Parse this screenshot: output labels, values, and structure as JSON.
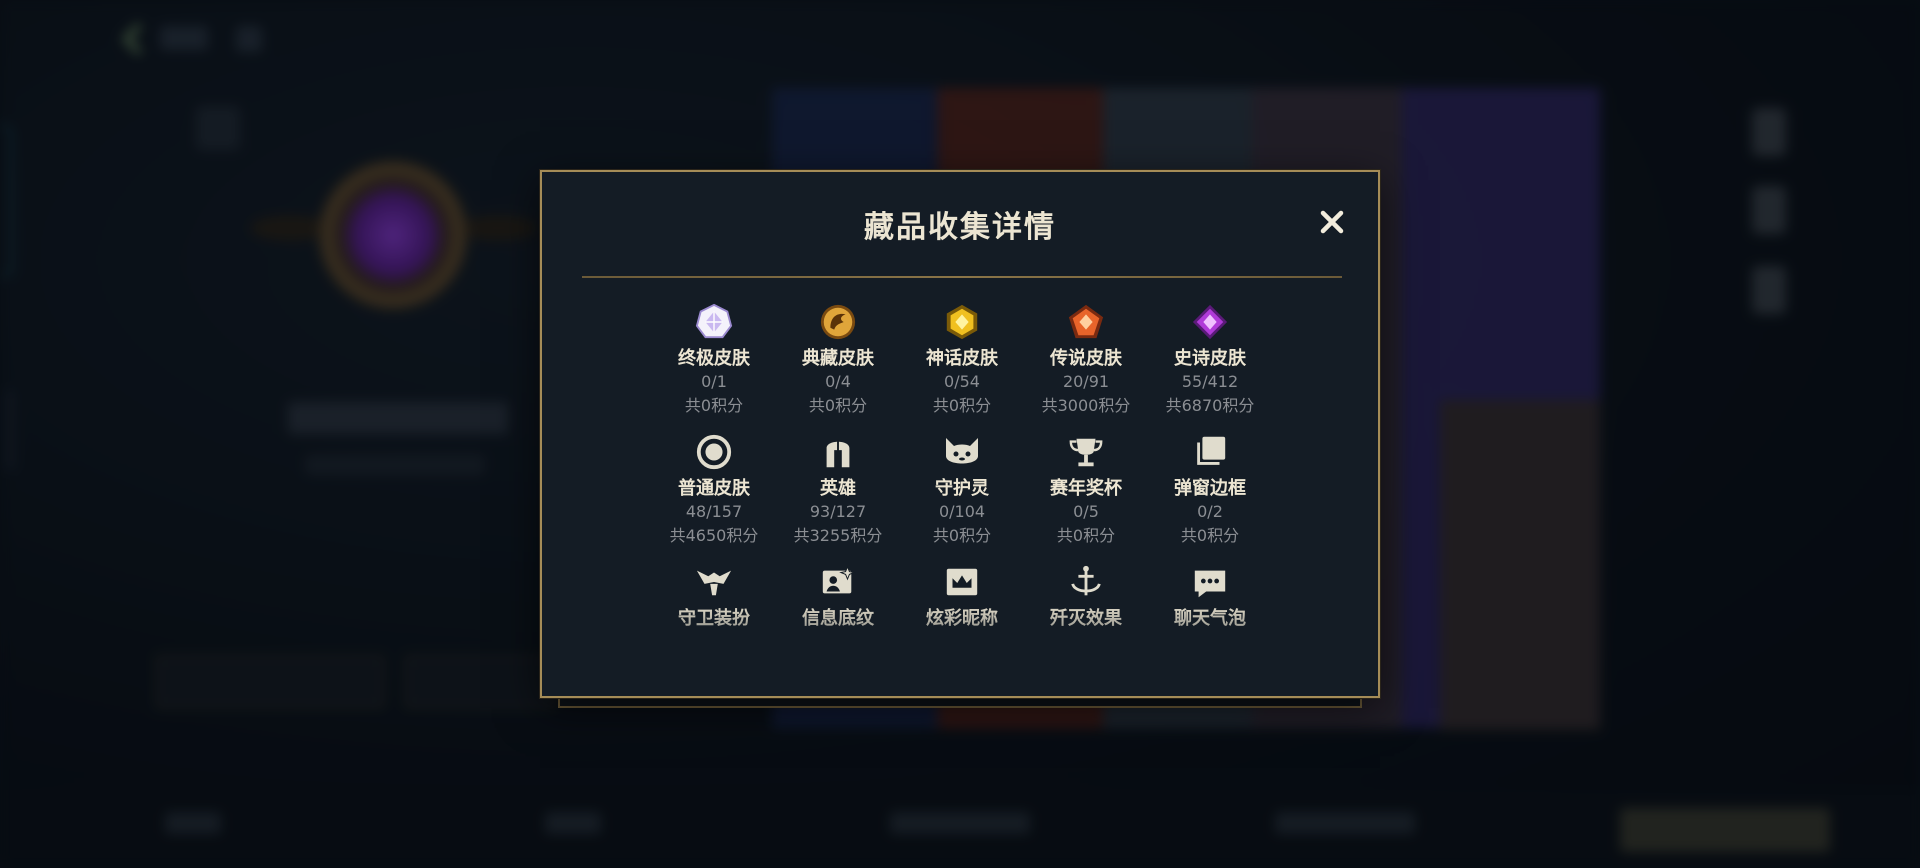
{
  "modal": {
    "title": "藏品收集详情",
    "close_icon": "close-icon"
  },
  "collections": [
    {
      "icon": "ultimate-skin-icon",
      "name": "终极皮肤",
      "count": "0/1",
      "points": "共0积分",
      "color": "#c9b8f0"
    },
    {
      "icon": "classic-skin-icon",
      "name": "典藏皮肤",
      "count": "0/4",
      "points": "共0积分",
      "color": "#e0a53a"
    },
    {
      "icon": "mythic-skin-icon",
      "name": "神话皮肤",
      "count": "0/54",
      "points": "共0积分",
      "color": "#f0c020"
    },
    {
      "icon": "legendary-skin-icon",
      "name": "传说皮肤",
      "count": "20/91",
      "points": "共3000积分",
      "color": "#e8642a"
    },
    {
      "icon": "epic-skin-icon",
      "name": "史诗皮肤",
      "count": "55/412",
      "points": "共6870积分",
      "color": "#b03ad8"
    },
    {
      "icon": "normal-skin-icon",
      "name": "普通皮肤",
      "count": "48/157",
      "points": "共4650积分",
      "color": "#e0dccd"
    },
    {
      "icon": "hero-helmet-icon",
      "name": "英雄",
      "count": "93/127",
      "points": "共3255积分",
      "color": "#e0dccd"
    },
    {
      "icon": "guardian-spirit-icon",
      "name": "守护灵",
      "count": "0/104",
      "points": "共0积分",
      "color": "#e0dccd"
    },
    {
      "icon": "trophy-icon",
      "name": "赛年奖杯",
      "count": "0/5",
      "points": "共0积分",
      "color": "#e0dccd"
    },
    {
      "icon": "popup-frame-icon",
      "name": "弹窗边框",
      "count": "0/2",
      "points": "共0积分",
      "color": "#e0dccd"
    },
    {
      "icon": "guardian-outfit-icon",
      "name": "守卫装扮",
      "count": "",
      "points": "",
      "color": "#e0dccd"
    },
    {
      "icon": "profile-card-icon",
      "name": "信息底纹",
      "count": "",
      "points": "",
      "color": "#e0dccd"
    },
    {
      "icon": "nickname-crown-icon",
      "name": "炫彩昵称",
      "count": "",
      "points": "",
      "color": "#e0dccd"
    },
    {
      "icon": "dunk-effect-icon",
      "name": "歼灭效果",
      "count": "",
      "points": "",
      "color": "#e0dccd"
    },
    {
      "icon": "chat-bubble-icon",
      "name": "聊天气泡",
      "count": "",
      "points": "",
      "color": "#e0dccd"
    }
  ]
}
